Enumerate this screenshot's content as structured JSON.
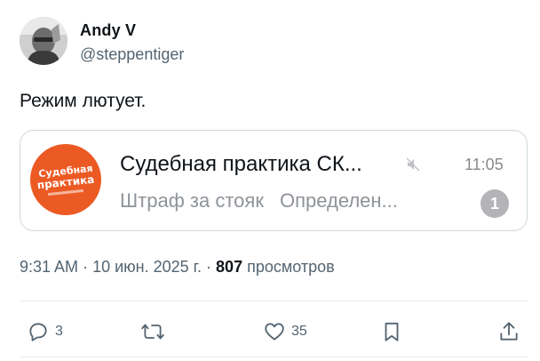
{
  "author": {
    "name": "Andy V",
    "handle": "@steppentiger"
  },
  "tweet": {
    "text": "Режим лютует."
  },
  "embed": {
    "logo_line1": "Судебная",
    "logo_line2": "практика",
    "channel_name": "Судебная практика СК...",
    "time": "11:05",
    "preview_part1": "Штраф за стояк",
    "preview_part2": "Определен...",
    "unread_count": "1",
    "muted_icon": "mute-icon",
    "accent_color": "#ec5a24"
  },
  "meta": {
    "time": "9:31 AM",
    "sep1": "·",
    "date": "10 июн. 2025 г.",
    "sep2": "·",
    "views_count": "807",
    "views_label": "просмотров"
  },
  "actions": {
    "replies": "3",
    "retweets": "",
    "likes": "35",
    "bookmark": "",
    "share": ""
  }
}
